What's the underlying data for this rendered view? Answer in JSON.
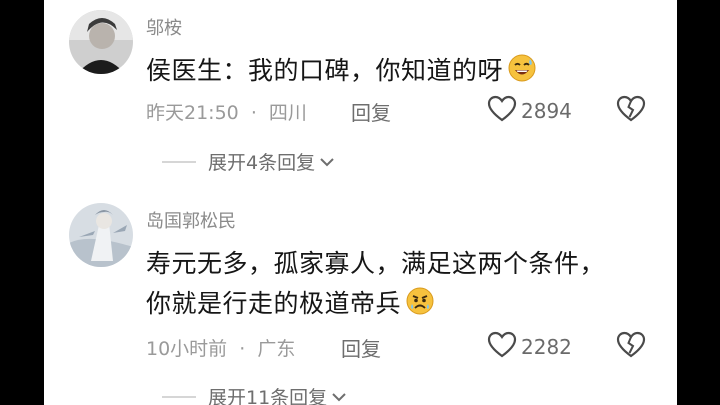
{
  "comments": [
    {
      "username": "邬桉",
      "lines": [
        "侯医生：我的口碑，你知道的呀"
      ],
      "emoji": "smiling-sweat-emoji",
      "meta_time": "昨天21:50",
      "meta_sep": "·",
      "meta_location": "四川",
      "reply_label": "回复",
      "like_count": "2894",
      "expand_label": "展开4条回复"
    },
    {
      "username": "岛国郭松民",
      "lines": [
        "寿元无多，孤家寡人，满足这两个条件，",
        "你就是行走的极道帝兵"
      ],
      "emoji": "anguished-emoji",
      "meta_time": "10小时前",
      "meta_sep": "·",
      "meta_location": "广东",
      "reply_label": "回复",
      "like_count": "2282",
      "expand_label": "展开11条回复"
    }
  ],
  "colors": {
    "background": "#ffffff",
    "letterbox": "#000000",
    "text_primary": "#161616",
    "text_secondary": "#8a8a8a"
  },
  "icons": {
    "like": "heart-outline-icon",
    "dislike": "broken-heart-icon",
    "expand": "chevron-down-icon"
  }
}
